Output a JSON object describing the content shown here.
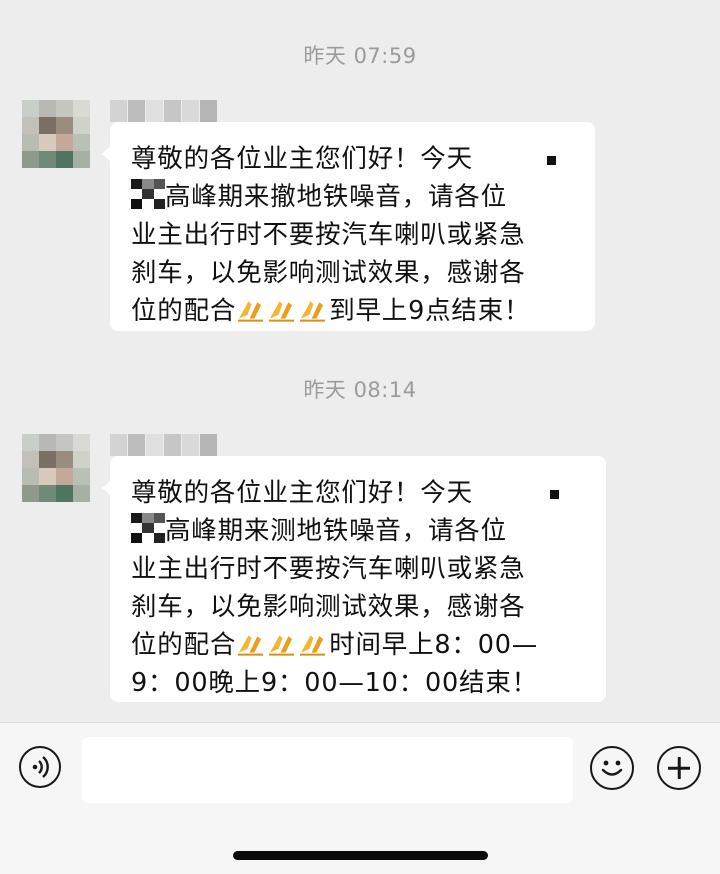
{
  "messages": [
    {
      "timestamp": "昨天 07:59",
      "lines": [
        {
          "a": "尊敬的各位业主您们好！今天",
          "b": ""
        },
        {
          "a": "",
          "b": "高峰期来撤地铁噪音，请各位"
        },
        {
          "a": "业主出行时不要按汽车喇叭或紧急",
          "b": ""
        },
        {
          "a": "刹车，以免影响测试效果，感谢各",
          "b": ""
        },
        {
          "a": "位的配合",
          "b": "到早上9点结束！"
        }
      ]
    },
    {
      "timestamp": "昨天 08:14",
      "lines": [
        {
          "a": "尊敬的各位业主您们好！今天",
          "b": ""
        },
        {
          "a": "",
          "b": "高峰期来测地铁噪音，请各位"
        },
        {
          "a": "业主出行时不要按汽车喇叭或紧急",
          "b": ""
        },
        {
          "a": "刹车，以免影响测试效果，感谢各",
          "b": ""
        },
        {
          "a": "位的配合",
          "b": "时间早上8：00—"
        },
        {
          "a": "9：00晚上9：00—10：00结束！",
          "b": ""
        }
      ]
    }
  ],
  "input_bar": {
    "placeholder": "",
    "voice_icon": "voice-icon",
    "emoji_icon": "emoji-icon",
    "plus_icon": "plus-icon"
  },
  "colors": {
    "background": "#ededed",
    "bubble": "#ffffff",
    "timestamp_text": "#9b9b9b"
  }
}
